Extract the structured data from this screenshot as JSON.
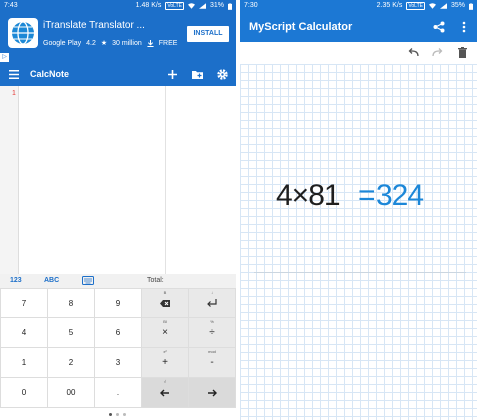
{
  "left": {
    "status": {
      "time": "7:43",
      "net": "1.48 K/s",
      "carrier": "VoLTE",
      "battery": "31%"
    },
    "ad": {
      "title": "iTranslate Translator ...",
      "store": "Google Play",
      "rating": "4.2",
      "downloads": "30 million",
      "price": "FREE",
      "install_label": "INSTALL",
      "ad_flag": "▷"
    },
    "appbar": {
      "title": "CalcNote"
    },
    "editor": {
      "line_number": "1"
    },
    "keyboard": {
      "tabs": {
        "numeric": "123",
        "alpha": "ABC",
        "total": "Total:"
      },
      "keys": {
        "k7": "7",
        "k8": "8",
        "k9": "9",
        "k4": "4",
        "k5": "5",
        "k6": "6",
        "k1": "1",
        "k2": "2",
        "k3": "3",
        "k0": "0",
        "k00": "00",
        "kdot": ".",
        "plus": "+",
        "minus": "-",
        "multiply": "×",
        "divide": "÷",
        "sup_bksp": "B",
        "sup_bksp2": "Bl",
        "sup_enter": "↓",
        "sup_mod": "%",
        "sup_mod2": "mod",
        "sup_x": "x²",
        "sup_r": "√"
      }
    }
  },
  "right": {
    "status": {
      "time": "7:30",
      "net": "2.35 K/s",
      "carrier": "VoLTE",
      "battery": "35%"
    },
    "appbar": {
      "title": "MyScript Calculator"
    },
    "expression": {
      "lhs": "4×81",
      "equals": "=",
      "result": "324"
    }
  },
  "colors": {
    "left_primary": "#1c6fc9",
    "right_primary": "#1c78d4",
    "result_blue": "#1c87d8",
    "line_number_red": "#e53935"
  }
}
